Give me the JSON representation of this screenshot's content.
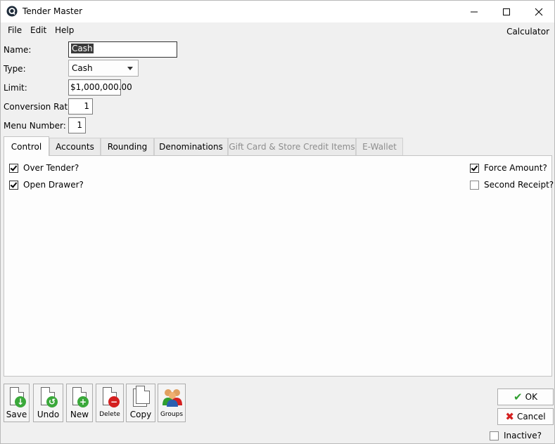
{
  "window": {
    "title": "Tender Master",
    "icons": {
      "app": "app-logo-icon",
      "minimize": "minimize-icon",
      "maximize": "maximize-icon",
      "close": "close-icon"
    }
  },
  "menu": {
    "file": "File",
    "edit": "Edit",
    "help": "Help",
    "calculator": "Calculator"
  },
  "form": {
    "name_label": "Name:",
    "name_value": "Cash",
    "type_label": "Type:",
    "type_value": "Cash",
    "limit_label": "Limit:",
    "limit_value": "$1,000,000.00",
    "rate_label": "Conversion Rate:",
    "rate_value": "1",
    "menu_number_label": "Menu Number:",
    "menu_number_value": "1"
  },
  "tabs": [
    "Control",
    "Accounts",
    "Rounding",
    "Denominations",
    "Gift Card & Store Credit Items",
    "E-Wallet"
  ],
  "control": {
    "over_tender": {
      "label": "Over Tender?",
      "checked": true
    },
    "open_drawer": {
      "label": "Open Drawer?",
      "checked": true
    },
    "force_amount": {
      "label": "Force Amount?",
      "checked": true
    },
    "second_receipt": {
      "label": "Second Receipt?",
      "checked": false
    }
  },
  "toolbar": {
    "save": "Save",
    "undo": "Undo",
    "new": "New",
    "delete": "Delete",
    "copy": "Copy",
    "groups": "Groups"
  },
  "dialog": {
    "ok": "OK",
    "cancel": "Cancel",
    "inactive": "Inactive?"
  },
  "colors": {
    "accent_green": "#2f9e2f",
    "danger_red": "#d42020"
  }
}
